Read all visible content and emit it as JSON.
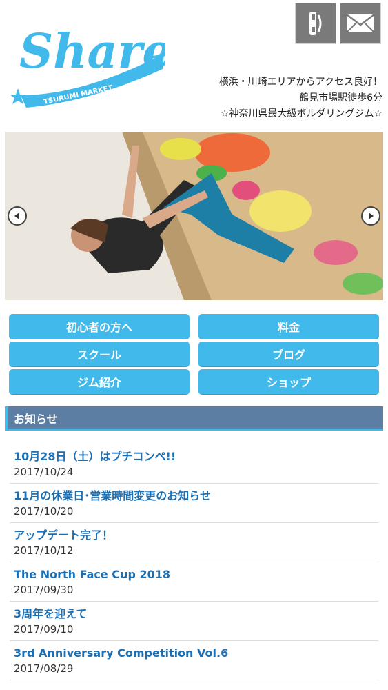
{
  "header": {
    "logo_text": "Share",
    "logo_sub": "TSURUMI MARKET",
    "tagline": [
      "横浜・川崎エリアからアクセス良好！",
      "鶴見市場駅徒歩6分",
      "☆神奈川県最大級ボルダリングジム☆"
    ],
    "tel_icon": "phone-icon",
    "mail_icon": "mail-icon"
  },
  "nav": [
    {
      "label": "初心者の方へ"
    },
    {
      "label": "料金"
    },
    {
      "label": "スクール"
    },
    {
      "label": "ブログ"
    },
    {
      "label": "ジム紹介"
    },
    {
      "label": "ショップ"
    }
  ],
  "news": {
    "heading": "お知らせ",
    "items": [
      {
        "title": "10月28日（土）はプチコンペ!!",
        "date": "2017/10/24"
      },
      {
        "title": "11月の休業日･営業時間変更のお知らせ",
        "date": "2017/10/20"
      },
      {
        "title": "アップデート完了！",
        "date": "2017/10/12"
      },
      {
        "title": "The North Face Cup 2018",
        "date": "2017/09/30"
      },
      {
        "title": "3周年を迎えて",
        "date": "2017/09/10"
      },
      {
        "title": "3rd Anniversary Competition Vol.6",
        "date": "2017/08/29"
      }
    ]
  },
  "colors": {
    "accent": "#41b9ea",
    "news_header": "#5d7ea3",
    "link": "#1b6fb5"
  }
}
